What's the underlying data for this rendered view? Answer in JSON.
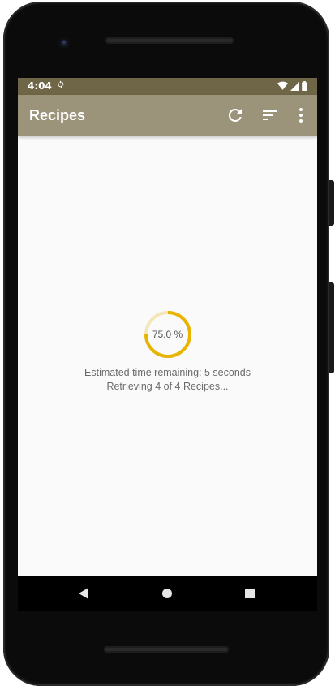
{
  "status_bar": {
    "time": "4:04",
    "sync_icon": "sync-icon",
    "wifi_icon": "wifi-icon",
    "signal_icon": "signal-icon",
    "battery_icon": "battery-icon"
  },
  "app_bar": {
    "title": "Recipes",
    "actions": [
      {
        "name": "refresh",
        "icon": "refresh-icon"
      },
      {
        "name": "sort",
        "icon": "sort-icon"
      },
      {
        "name": "more",
        "icon": "more-vert-icon"
      }
    ]
  },
  "loader": {
    "progress_percent": 75.0,
    "progress_label": "75.0 %",
    "time_remaining": "Estimated time remaining: 5 seconds",
    "retrieving": "Retrieving 4 of 4 Recipes...",
    "arc_color": "#e8b400",
    "track_color": "#f3e7b8"
  },
  "nav_bar": {
    "back_icon": "back-triangle-icon",
    "home_icon": "home-circle-icon",
    "recents_icon": "recents-square-icon"
  },
  "colors": {
    "status_bar": "#6f6647",
    "app_bar": "#9b947a",
    "screen_bg": "#fafafa",
    "accent": "#e8b400"
  }
}
